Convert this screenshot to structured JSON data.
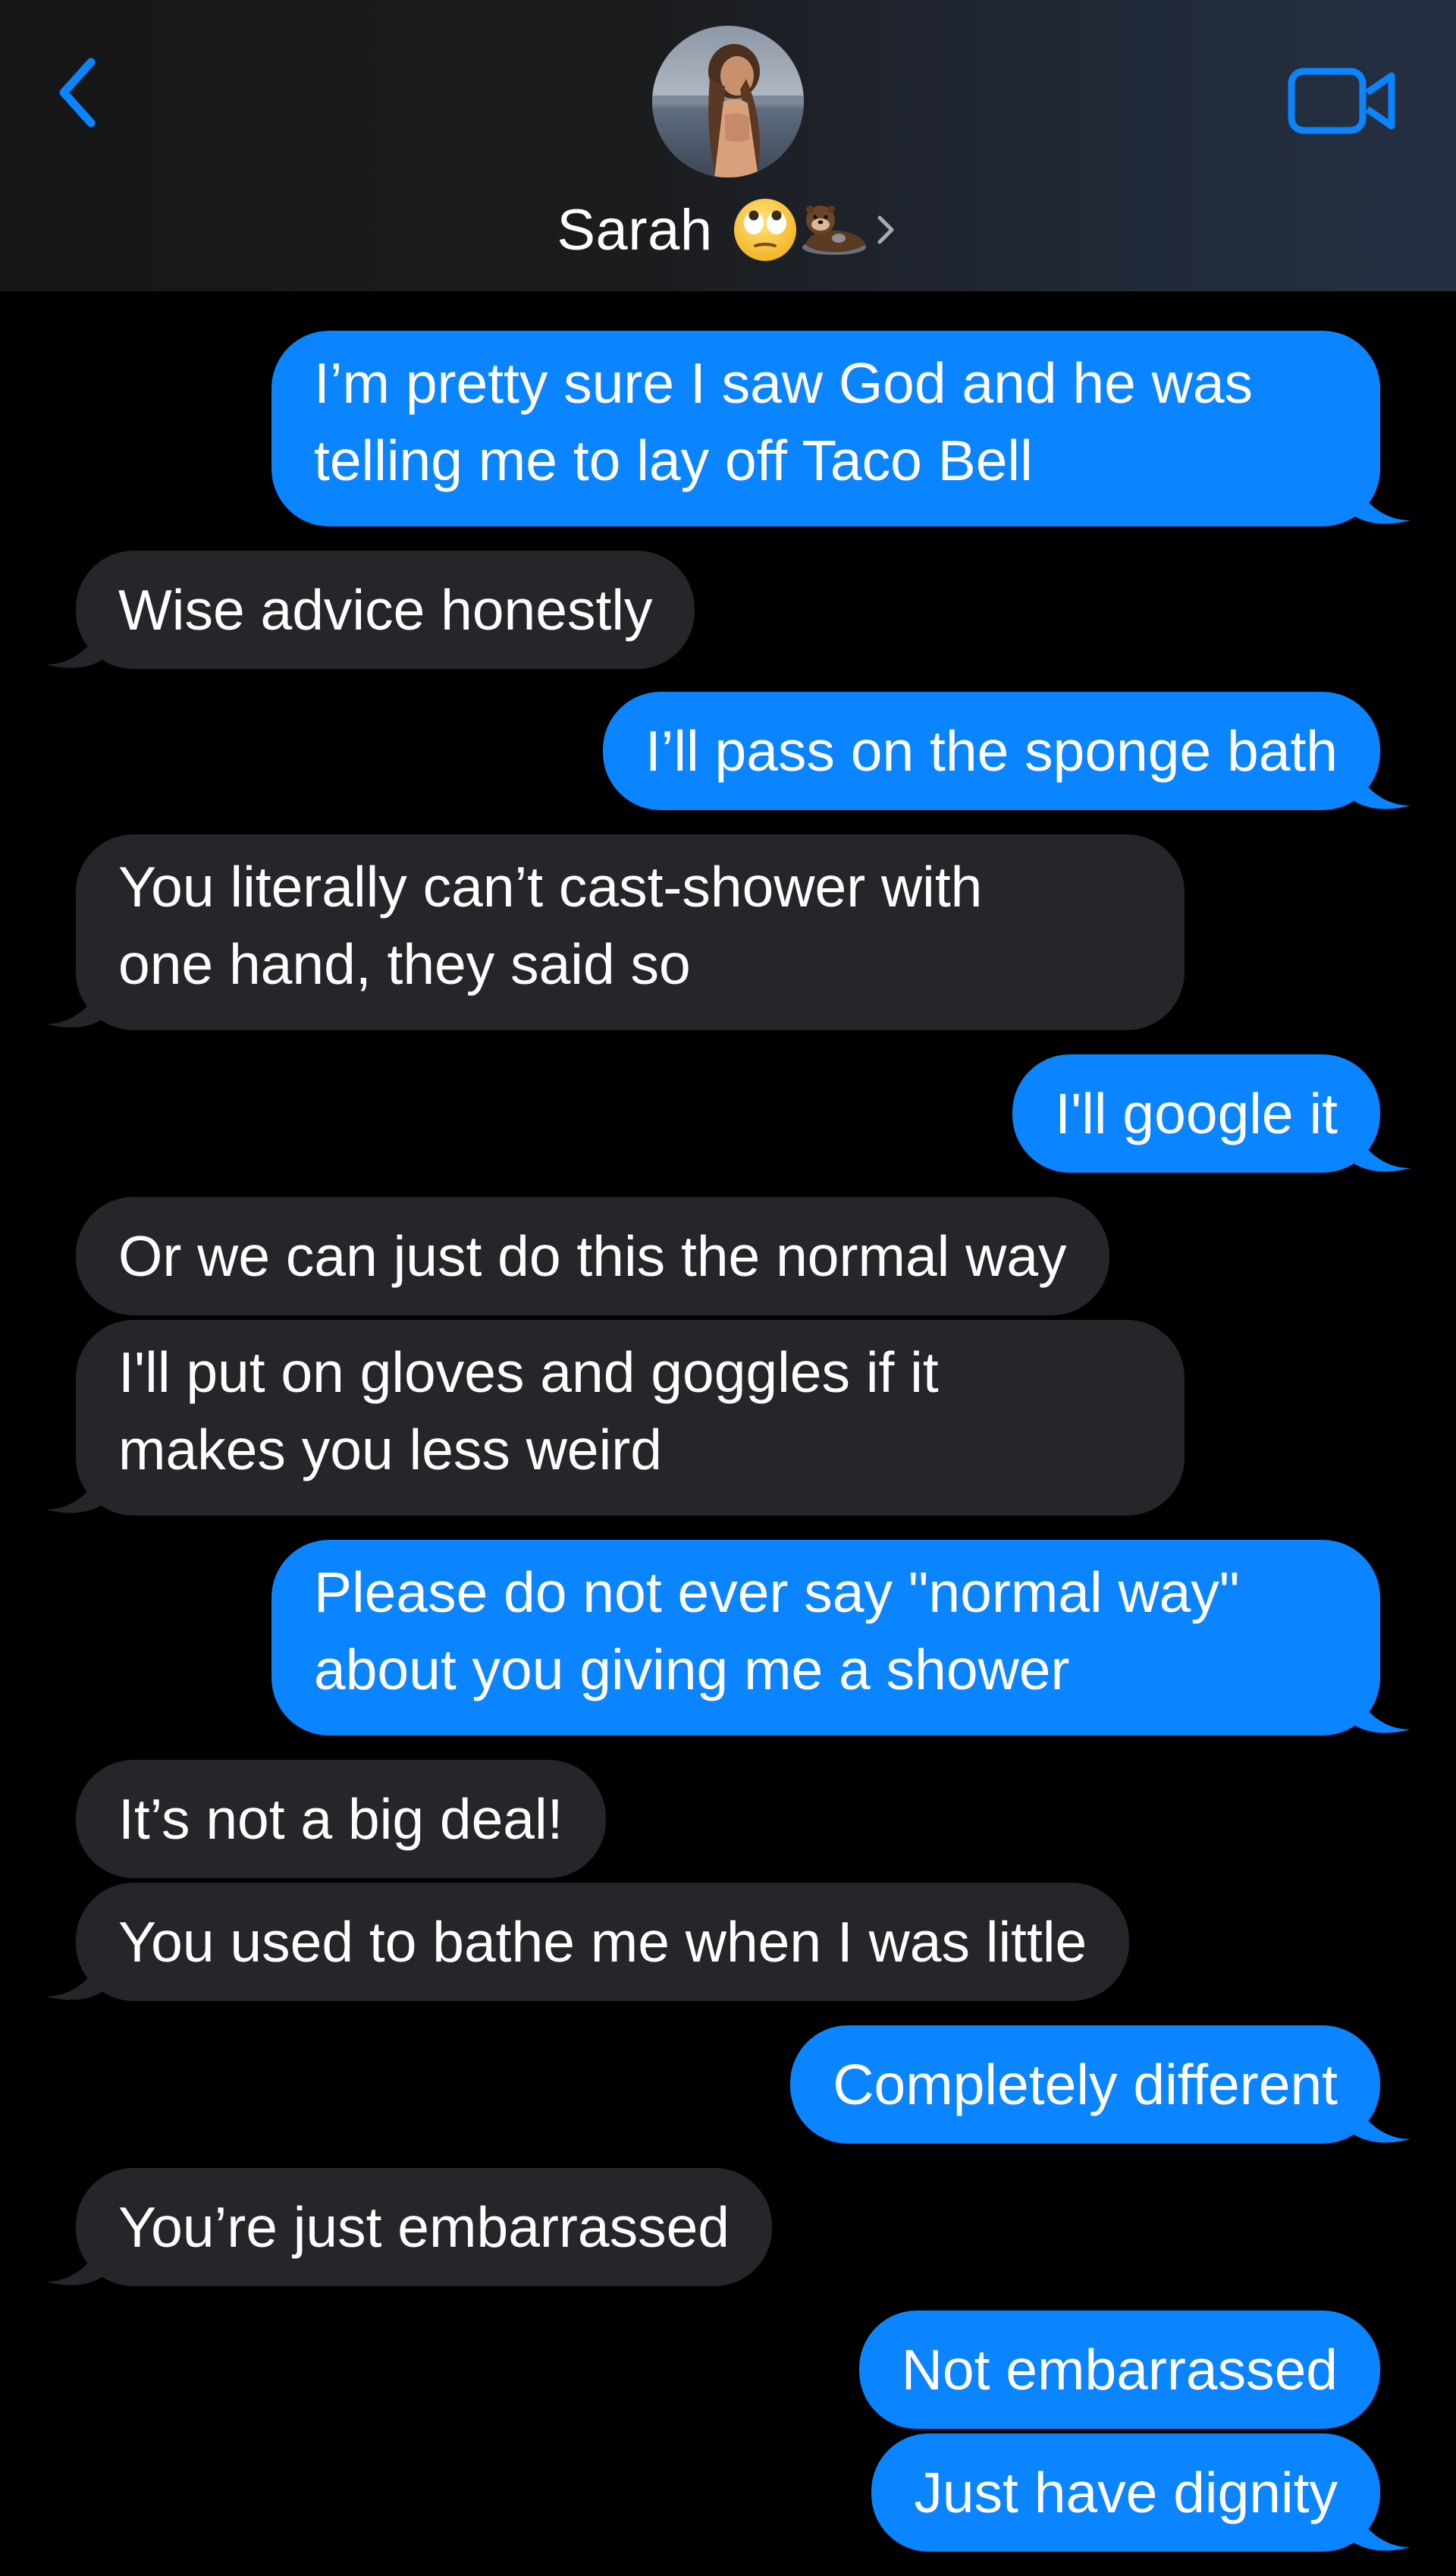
{
  "header": {
    "contact_name": "Sarah",
    "name_emojis": [
      "eye-roll-emoji",
      "otter-emoji"
    ],
    "back_icon": "chevron-left-icon",
    "video_icon": "video-camera-icon",
    "accent_color": "#0a84ff"
  },
  "colors": {
    "outgoing_bubble": "#0a84ff",
    "incoming_bubble": "#26252a",
    "background": "#000000",
    "text": "#ffffff"
  },
  "messages": [
    {
      "dir": "out",
      "lines": [
        "I’m pretty sure I saw God and he was",
        "telling me to lay off Taco Bell"
      ],
      "tail": true
    },
    {
      "dir": "in",
      "lines": [
        "Wise advice honestly"
      ],
      "tail": true
    },
    {
      "dir": "out",
      "lines": [
        "I’ll pass on the sponge bath"
      ],
      "tail": true
    },
    {
      "dir": "in",
      "lines": [
        "You literally can’t cast-shower with",
        "one hand, they said so"
      ],
      "tail": true
    },
    {
      "dir": "out",
      "lines": [
        "I'll google it"
      ],
      "tail": true
    },
    {
      "dir": "in",
      "lines": [
        "Or we can just do this the normal way"
      ],
      "tail": false
    },
    {
      "dir": "in",
      "lines": [
        "I'll put on gloves and goggles if it",
        "makes you less weird"
      ],
      "tail": true
    },
    {
      "dir": "out",
      "lines": [
        "Please do not ever say \"normal way\"",
        "about you giving me a shower"
      ],
      "tail": true
    },
    {
      "dir": "in",
      "lines": [
        "It’s not a big deal!"
      ],
      "tail": false
    },
    {
      "dir": "in",
      "lines": [
        "You used to bathe me when I was little"
      ],
      "tail": true
    },
    {
      "dir": "out",
      "lines": [
        "Completely different"
      ],
      "tail": true
    },
    {
      "dir": "in",
      "lines": [
        "You’re just embarrassed"
      ],
      "tail": true
    },
    {
      "dir": "out",
      "lines": [
        "Not embarrassed"
      ],
      "tail": false
    },
    {
      "dir": "out",
      "lines": [
        "Just have dignity"
      ],
      "tail": true
    }
  ]
}
